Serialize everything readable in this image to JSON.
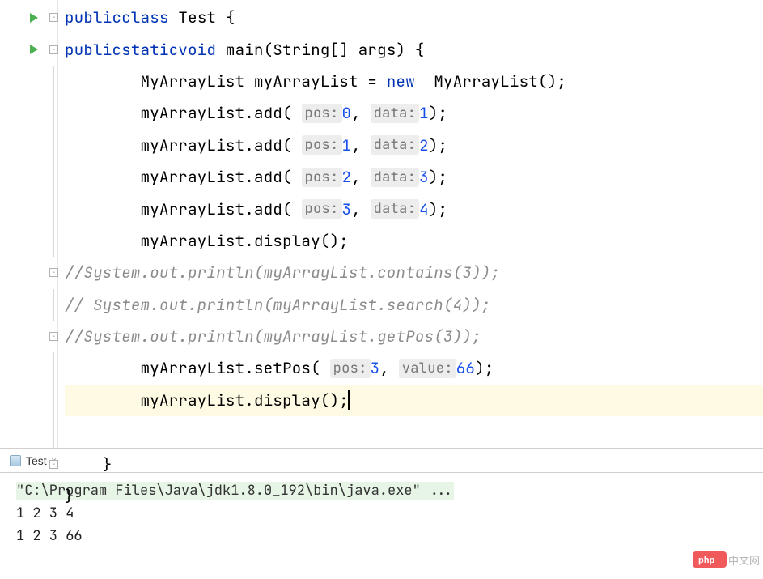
{
  "code": {
    "lines": [
      {
        "indent": 0,
        "type": "class_decl",
        "kw1": "public",
        "kw2": "class",
        "cls": "Test",
        "open": "{"
      },
      {
        "indent": 1,
        "type": "method_decl",
        "kw1": "public",
        "kw2": "static",
        "kw3": "void",
        "name": "main",
        "params": "(String[] args)",
        "open": "{"
      },
      {
        "indent": 2,
        "type": "new_stmt",
        "cls": "MyArrayList",
        "var": "myArrayList",
        "eq": "=",
        "kw": "new",
        "ctor": "MyArrayList",
        "suffix": "();"
      },
      {
        "indent": 2,
        "type": "call_hint2",
        "obj": "myArrayList",
        "method": "add",
        "hint1": "pos:",
        "val1": "0",
        "hint2": "data:",
        "val2": "1"
      },
      {
        "indent": 2,
        "type": "call_hint2",
        "obj": "myArrayList",
        "method": "add",
        "hint1": "pos:",
        "val1": "1",
        "hint2": "data:",
        "val2": "2"
      },
      {
        "indent": 2,
        "type": "call_hint2",
        "obj": "myArrayList",
        "method": "add",
        "hint1": "pos:",
        "val1": "2",
        "hint2": "data:",
        "val2": "3"
      },
      {
        "indent": 2,
        "type": "call_hint2",
        "obj": "myArrayList",
        "method": "add",
        "hint1": "pos:",
        "val1": "3",
        "hint2": "data:",
        "val2": "4"
      },
      {
        "indent": 2,
        "type": "call",
        "text": "myArrayList.display();"
      },
      {
        "indent": 2,
        "type": "comment",
        "text": "//System.out.println(myArrayList.contains(3));"
      },
      {
        "indent": 2,
        "type": "comment",
        "text": "// System.out.println(myArrayList.search(4));"
      },
      {
        "indent": 2,
        "type": "comment",
        "text": "//System.out.println(myArrayList.getPos(3));"
      },
      {
        "indent": 2,
        "type": "call_hint2",
        "obj": "myArrayList",
        "method": "setPos",
        "hint1": "pos:",
        "val1": "3",
        "hint2": "value:",
        "val2": "66"
      },
      {
        "indent": 2,
        "type": "call_cursor",
        "text": "myArrayList.display();"
      },
      {
        "indent": 2,
        "type": "blank"
      },
      {
        "indent": 1,
        "type": "close",
        "text": "}"
      },
      {
        "indent": 0,
        "type": "close",
        "text": "}"
      }
    ]
  },
  "console": {
    "tab": "Test",
    "cmd": "\"C:\\Program Files\\Java\\jdk1.8.0_192\\bin\\java.exe\" ...",
    "out1": "1 2 3 4",
    "out2": "1 2 3 66"
  },
  "watermark": {
    "brand": "php",
    "site": "中文网"
  }
}
